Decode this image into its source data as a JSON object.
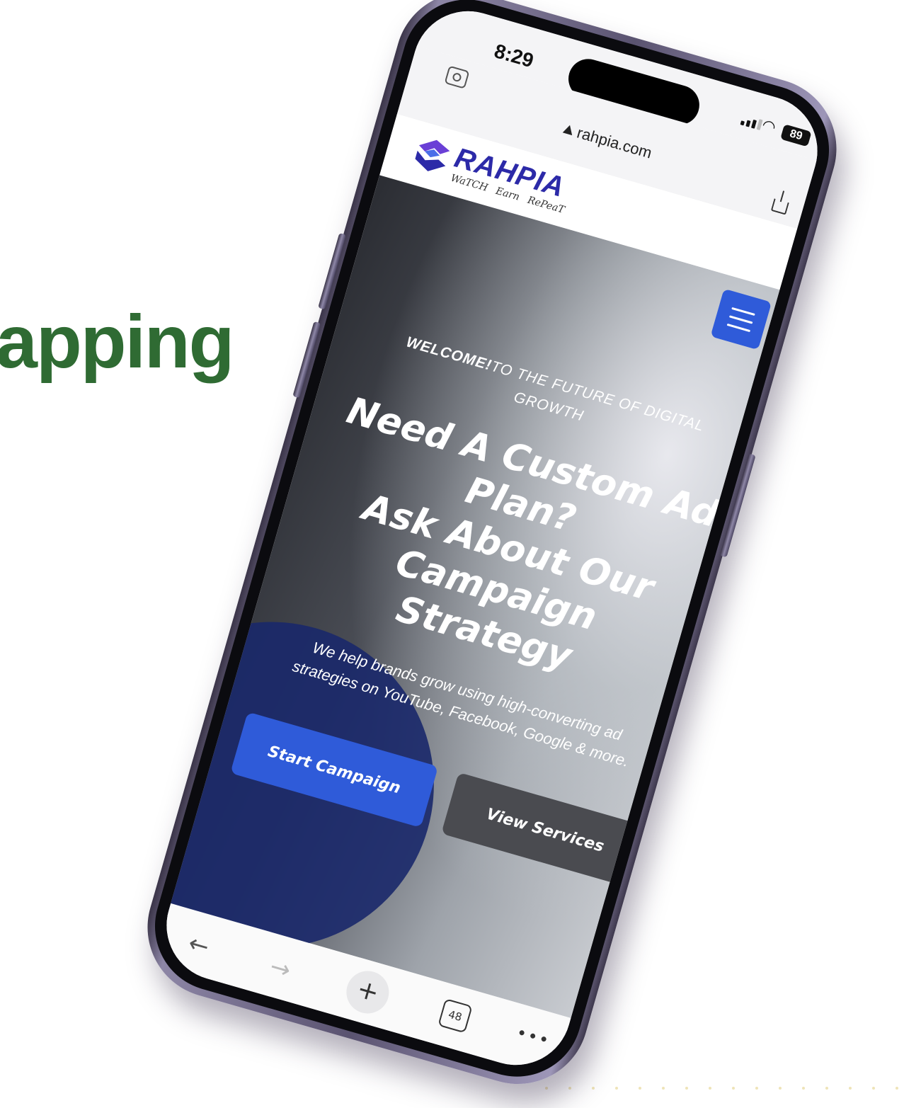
{
  "side_heading": "apping",
  "colors": {
    "heading_green": "#2f6b33",
    "brand_blue": "#2f5bd9",
    "secondary_button": "#4a4b50",
    "logo_purple": "#2c2aa8"
  },
  "status_bar": {
    "time": "8:29",
    "battery": "89",
    "icons": [
      "signal-icon",
      "wifi-icon",
      "battery-icon"
    ]
  },
  "browser": {
    "domain": "rahpia.com",
    "icons": [
      "camera-icon",
      "lock-icon",
      "share-icon"
    ]
  },
  "site": {
    "logo_name": "RAHPIA",
    "logo_tagline": "WaTCH Earn RePeaT",
    "menu_icon": "hamburger-menu-icon"
  },
  "hero": {
    "welcome_bold": "WELCOME!",
    "welcome_rest": "TO THE FUTURE OF DIGITAL GROWTH",
    "headline_line1": "Need A Custom Ad",
    "headline_line2": "Plan?",
    "headline_line3": "Ask About Our",
    "headline_line4": "Campaign Strategy",
    "subtext": "We help brands grow using high-converting ad strategies on YouTube, Facebook, Google & more.",
    "primary_button": "Start Campaign",
    "secondary_button": "View Services"
  },
  "toolbar": {
    "tab_count": "48",
    "icons": [
      "back-arrow-icon",
      "forward-arrow-icon",
      "new-tab-plus-icon",
      "tabs-icon",
      "more-icon"
    ]
  }
}
